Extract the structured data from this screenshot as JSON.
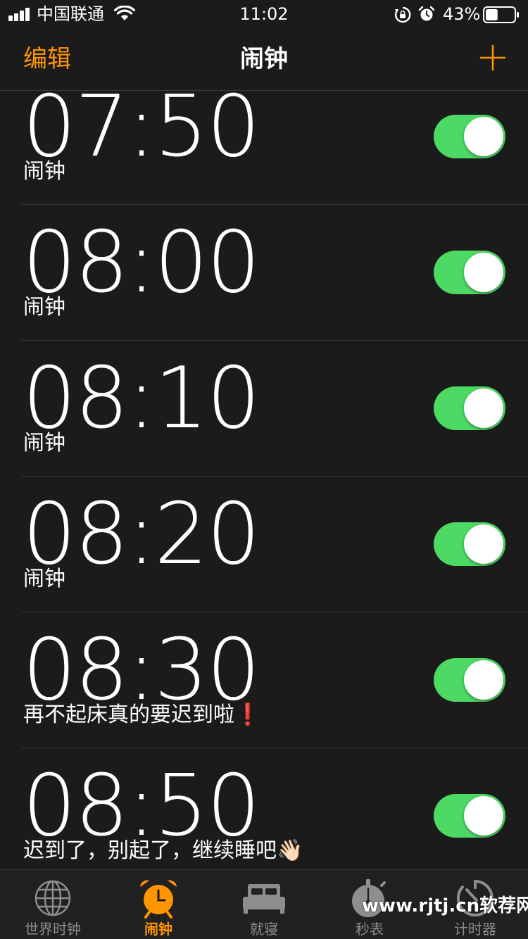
{
  "status_bar": {
    "carrier": "中国联通",
    "time": "11:02",
    "battery_percent": "43%",
    "battery_level": 0.43,
    "icons": [
      "signal-bars-icon",
      "wifi-icon",
      "rotation-lock-icon",
      "alarm-icon",
      "battery-icon"
    ]
  },
  "nav": {
    "edit_label": "编辑",
    "title": "闹钟",
    "add_icon": "plus-icon"
  },
  "alarms": [
    {
      "time": "07:50",
      "label": "闹钟",
      "enabled": true
    },
    {
      "time": "08:00",
      "label": "闹钟",
      "enabled": true
    },
    {
      "time": "08:10",
      "label": "闹钟",
      "enabled": true
    },
    {
      "time": "08:20",
      "label": "闹钟",
      "enabled": true
    },
    {
      "time": "08:30",
      "label": "再不起床真的要迟到啦❗",
      "enabled": true
    },
    {
      "time": "08:50",
      "label": "迟到了，别起了，继续睡吧👋🏻",
      "enabled": true
    }
  ],
  "tabs": [
    {
      "label": "世界时钟",
      "icon": "globe-icon",
      "active": false
    },
    {
      "label": "闹钟",
      "icon": "alarm-clock-icon",
      "active": true
    },
    {
      "label": "就寝",
      "icon": "bed-icon",
      "active": false
    },
    {
      "label": "秒表",
      "icon": "stopwatch-icon",
      "active": false
    },
    {
      "label": "计时器",
      "icon": "timer-icon",
      "active": false
    }
  ],
  "watermark": "www.rjtj.cn软荐网",
  "colors": {
    "accent": "#ff9500",
    "toggle_on": "#4cd964",
    "background": "#1b1b1b",
    "tab_inactive": "#8e8e8e"
  }
}
